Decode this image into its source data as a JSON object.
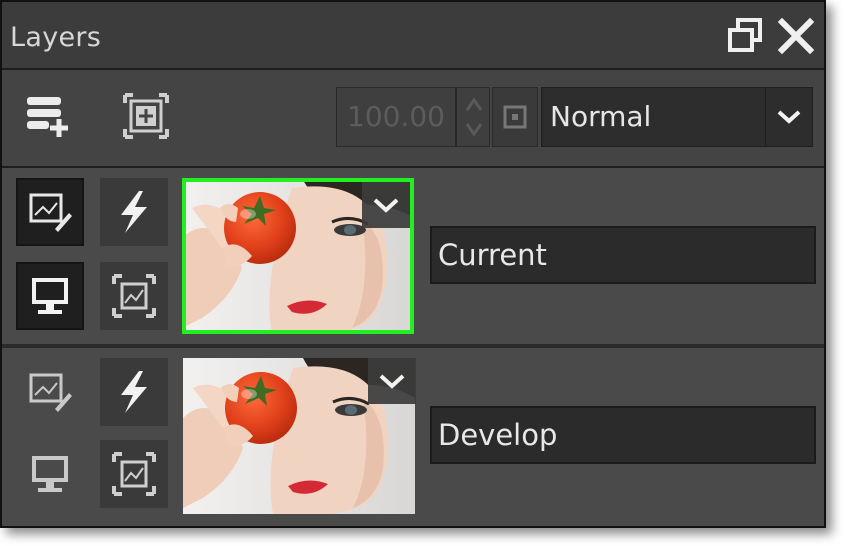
{
  "panel": {
    "title": "Layers",
    "icons": {
      "float": "float-window-icon",
      "close": "close-icon"
    }
  },
  "toolbar": {
    "add_layer_icon": "add-layer-icon",
    "fit_icon": "fit-layer-icon",
    "opacity_value": "100.00",
    "reset_icon": "reset-opacity-icon",
    "blend_mode": "Normal",
    "dropdown_icon": "chevron-down-icon"
  },
  "layers": [
    {
      "name": "Current",
      "selected": true,
      "edit_icon": "edit-layer-icon",
      "effects_icon": "lightning-icon",
      "visibility_icon": "monitor-icon",
      "mask_icon": "mask-image-icon",
      "thumbnail": "woman-tomato-thumbnail"
    },
    {
      "name": "Develop",
      "selected": false,
      "edit_icon": "edit-layer-icon",
      "effects_icon": "lightning-icon",
      "visibility_icon": "monitor-icon",
      "mask_icon": "mask-image-icon",
      "thumbnail": "woman-tomato-thumbnail"
    }
  ],
  "colors": {
    "panel_bg": "#474747",
    "selected_border": "#22ee22",
    "text": "#e8e8e8"
  }
}
